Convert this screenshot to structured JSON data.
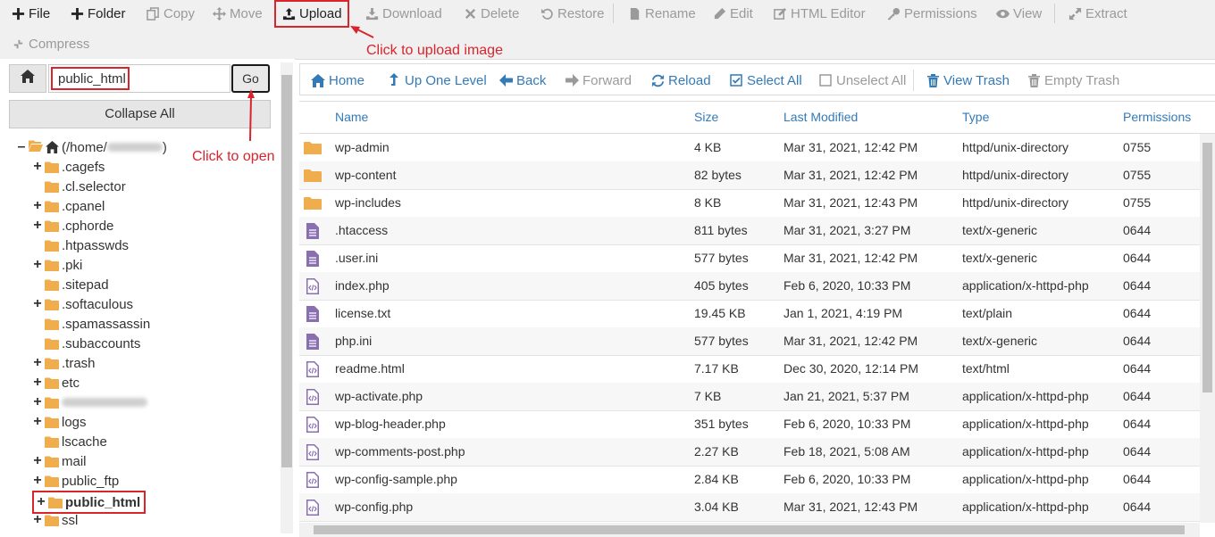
{
  "toolbar": {
    "row1": [
      {
        "key": "file",
        "label": "File",
        "icon": "plus-icon",
        "enabled": true
      },
      {
        "key": "folder",
        "label": "Folder",
        "icon": "plus-icon",
        "enabled": true
      },
      {
        "key": "copy",
        "label": "Copy",
        "icon": "copy-icon",
        "enabled": false
      },
      {
        "key": "move",
        "label": "Move",
        "icon": "move-arrows-icon",
        "enabled": false
      },
      {
        "key": "upload",
        "label": "Upload",
        "icon": "upload-icon",
        "enabled": true
      },
      {
        "key": "download",
        "label": "Download",
        "icon": "download-icon",
        "enabled": false
      },
      {
        "key": "delete",
        "label": "Delete",
        "icon": "x-icon",
        "enabled": false
      },
      {
        "key": "restore",
        "label": "Restore",
        "icon": "restore-icon",
        "enabled": false
      },
      {
        "key": "rename",
        "label": "Rename",
        "icon": "document-icon",
        "enabled": false
      },
      {
        "key": "edit",
        "label": "Edit",
        "icon": "pencil-icon",
        "enabled": false
      },
      {
        "key": "html_editor",
        "label": "HTML Editor",
        "icon": "edit-square-icon",
        "enabled": false
      },
      {
        "key": "permissions",
        "label": "Permissions",
        "icon": "key-icon",
        "enabled": false
      },
      {
        "key": "view",
        "label": "View",
        "icon": "eye-icon",
        "enabled": false
      },
      {
        "key": "extract",
        "label": "Extract",
        "icon": "expand-icon",
        "enabled": false
      }
    ],
    "row2": [
      {
        "key": "compress",
        "label": "Compress",
        "icon": "compress-icon",
        "enabled": false
      }
    ]
  },
  "annotations": {
    "upload": "Click to upload image",
    "go": "Click to open"
  },
  "location": {
    "path_value": "public_html",
    "go_label": "Go",
    "collapse_label": "Collapse All"
  },
  "tree": {
    "root_label_prefix": "(/home/",
    "root_label_suffix": ")",
    "items": [
      {
        "name": ".cagefs",
        "expandable": true
      },
      {
        "name": ".cl.selector",
        "expandable": false
      },
      {
        "name": ".cpanel",
        "expandable": true
      },
      {
        "name": ".cphorde",
        "expandable": true
      },
      {
        "name": ".htpasswds",
        "expandable": false
      },
      {
        "name": ".pki",
        "expandable": true
      },
      {
        "name": ".sitepad",
        "expandable": false
      },
      {
        "name": ".softaculous",
        "expandable": true
      },
      {
        "name": ".spamassassin",
        "expandable": false
      },
      {
        "name": ".subaccounts",
        "expandable": false
      },
      {
        "name": ".trash",
        "expandable": true
      },
      {
        "name": "etc",
        "expandable": true
      },
      {
        "name": "",
        "expandable": true,
        "blurred": true
      },
      {
        "name": "logs",
        "expandable": true
      },
      {
        "name": "lscache",
        "expandable": false
      },
      {
        "name": "mail",
        "expandable": true
      },
      {
        "name": "public_ftp",
        "expandable": true
      },
      {
        "name": "public_html",
        "expandable": true,
        "selected": true
      },
      {
        "name": "ssl",
        "expandable": true
      }
    ]
  },
  "nav": {
    "buttons": [
      {
        "key": "home",
        "label": "Home",
        "icon": "home-icon",
        "enabled": true
      },
      {
        "key": "up",
        "label": "Up One Level",
        "icon": "level-up-icon",
        "enabled": true
      },
      {
        "key": "back",
        "label": "Back",
        "icon": "arrow-left-icon",
        "enabled": true
      },
      {
        "key": "forward",
        "label": "Forward",
        "icon": "arrow-right-icon",
        "enabled": false
      },
      {
        "key": "reload",
        "label": "Reload",
        "icon": "refresh-icon",
        "enabled": true
      },
      {
        "key": "select_all",
        "label": "Select All",
        "icon": "checked-box-icon",
        "enabled": true
      },
      {
        "key": "unselect_all",
        "label": "Unselect All",
        "icon": "empty-box-icon",
        "enabled": false
      },
      {
        "key": "view_trash",
        "label": "View Trash",
        "icon": "trash-icon",
        "enabled": true
      },
      {
        "key": "empty_trash",
        "label": "Empty Trash",
        "icon": "trash-icon",
        "enabled": false
      }
    ]
  },
  "table": {
    "headers": [
      "Name",
      "Size",
      "Last Modified",
      "Type",
      "Permissions"
    ],
    "rows": [
      {
        "icon": "folder",
        "name": "wp-admin",
        "size": "4 KB",
        "modified": "Mar 31, 2021, 12:42 PM",
        "type": "httpd/unix-directory",
        "perm": "0755"
      },
      {
        "icon": "folder",
        "name": "wp-content",
        "size": "82 bytes",
        "modified": "Mar 31, 2021, 12:42 PM",
        "type": "httpd/unix-directory",
        "perm": "0755"
      },
      {
        "icon": "folder",
        "name": "wp-includes",
        "size": "8 KB",
        "modified": "Mar 31, 2021, 12:43 PM",
        "type": "httpd/unix-directory",
        "perm": "0755"
      },
      {
        "icon": "text",
        "name": ".htaccess",
        "size": "811 bytes",
        "modified": "Mar 31, 2021, 3:27 PM",
        "type": "text/x-generic",
        "perm": "0644"
      },
      {
        "icon": "text",
        "name": ".user.ini",
        "size": "577 bytes",
        "modified": "Mar 31, 2021, 12:42 PM",
        "type": "text/x-generic",
        "perm": "0644"
      },
      {
        "icon": "code",
        "name": "index.php",
        "size": "405 bytes",
        "modified": "Feb 6, 2020, 10:33 PM",
        "type": "application/x-httpd-php",
        "perm": "0644"
      },
      {
        "icon": "text",
        "name": "license.txt",
        "size": "19.45 KB",
        "modified": "Jan 1, 2021, 4:19 PM",
        "type": "text/plain",
        "perm": "0644"
      },
      {
        "icon": "text",
        "name": "php.ini",
        "size": "577 bytes",
        "modified": "Mar 31, 2021, 12:42 PM",
        "type": "text/x-generic",
        "perm": "0644"
      },
      {
        "icon": "code",
        "name": "readme.html",
        "size": "7.17 KB",
        "modified": "Dec 30, 2020, 12:14 PM",
        "type": "text/html",
        "perm": "0644"
      },
      {
        "icon": "code",
        "name": "wp-activate.php",
        "size": "7 KB",
        "modified": "Jan 21, 2021, 5:37 PM",
        "type": "application/x-httpd-php",
        "perm": "0644"
      },
      {
        "icon": "code",
        "name": "wp-blog-header.php",
        "size": "351 bytes",
        "modified": "Feb 6, 2020, 10:33 PM",
        "type": "application/x-httpd-php",
        "perm": "0644"
      },
      {
        "icon": "code",
        "name": "wp-comments-post.php",
        "size": "2.27 KB",
        "modified": "Feb 18, 2021, 5:08 AM",
        "type": "application/x-httpd-php",
        "perm": "0644"
      },
      {
        "icon": "code",
        "name": "wp-config-sample.php",
        "size": "2.84 KB",
        "modified": "Feb 6, 2020, 10:33 PM",
        "type": "application/x-httpd-php",
        "perm": "0644"
      },
      {
        "icon": "code",
        "name": "wp-config.php",
        "size": "3.04 KB",
        "modified": "Mar 31, 2021, 12:43 PM",
        "type": "application/x-httpd-php",
        "perm": "0644"
      }
    ]
  },
  "colors": {
    "link": "#337ab7",
    "disabled": "#9a9a9a",
    "folder": "#f0ad4e",
    "file": "#8a6fb0",
    "annotation": "#d9242c"
  }
}
